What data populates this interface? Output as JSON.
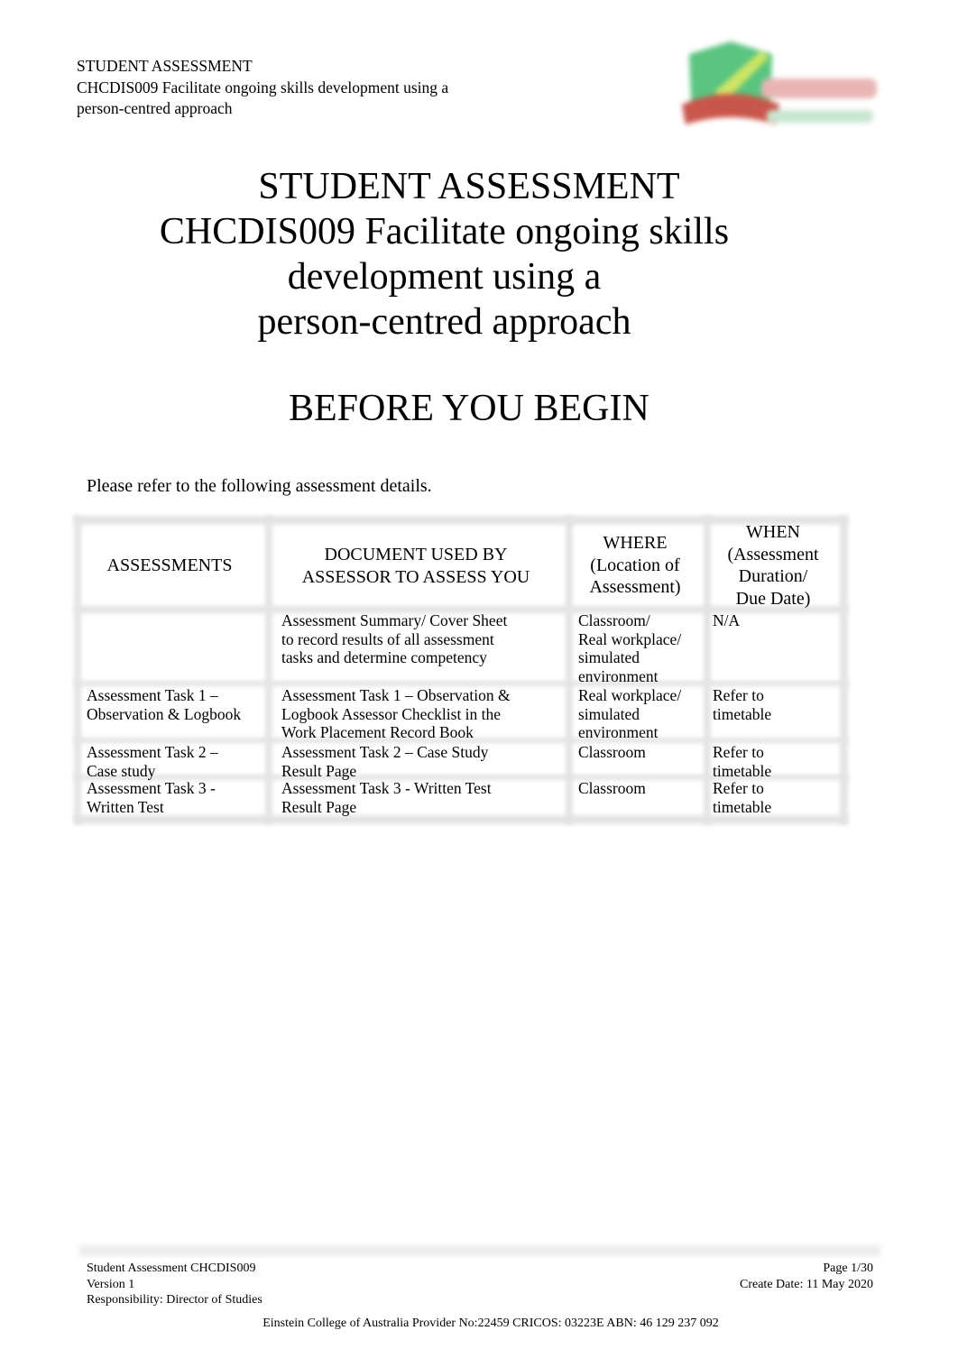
{
  "running_header": {
    "line1": "STUDENT ASSESSMENT",
    "line2": "CHCDIS009 Facilitate ongoing skills development using a",
    "line3": "person-centred approach"
  },
  "logo": {
    "icon": "college-crest-logo",
    "colors": {
      "shield_green": "#3dbb6a",
      "stripe_yellow": "#c6e04a",
      "ribbon_red": "#c0392b",
      "wordmark_red": "#e6a8a8",
      "wordmark_green": "#bfe3c9"
    }
  },
  "title": {
    "line1": "STUDENT ASSESSMENT",
    "line2": "CHCDIS009 Facilitate ongoing skills",
    "line3": "development using a",
    "line4": "person-centred approach"
  },
  "section_heading": "BEFORE YOU BEGIN",
  "intro_text": "Please refer to the following assessment details.",
  "table": {
    "headers": {
      "assessments": [
        "ASSESSMENTS"
      ],
      "document": [
        "DOCUMENT USED BY",
        "ASSESSOR TO ASSESS YOU"
      ],
      "where": [
        "WHERE",
        "(Location of",
        "Assessment)"
      ],
      "when": [
        "WHEN",
        "(Assessment",
        "Duration/",
        "Due Date)"
      ]
    },
    "rows": [
      {
        "assessment": [],
        "document": [
          "Assessment Summary/ Cover Sheet",
          "to record results of all assessment",
          "tasks and determine competency"
        ],
        "where": [
          "Classroom/",
          "Real workplace/",
          "simulated",
          "environment"
        ],
        "when": [
          "N/A"
        ]
      },
      {
        "assessment": [
          "Assessment Task 1 –",
          "Observation & Logbook"
        ],
        "document": [
          "Assessment Task 1 – Observation &",
          "Logbook Assessor Checklist in the",
          "Work Placement Record Book"
        ],
        "where": [
          "Real workplace/",
          "simulated",
          "environment"
        ],
        "when": [
          "Refer to",
          "timetable"
        ]
      },
      {
        "assessment": [
          "Assessment Task 2 –",
          "Case study"
        ],
        "document": [
          "Assessment Task 2 – Case Study",
          "Result Page"
        ],
        "where": [
          "Classroom"
        ],
        "when": [
          "Refer to",
          "timetable"
        ]
      },
      {
        "assessment": [
          "Assessment Task 3 -",
          "Written Test"
        ],
        "document": [
          "Assessment Task 3 - Written Test",
          "Result Page"
        ],
        "where": [
          "Classroom"
        ],
        "when": [
          "Refer to",
          "timetable"
        ]
      }
    ]
  },
  "footer": {
    "left": [
      "Student Assessment CHCDIS009",
      "Version 1",
      "Responsibility: Director of Studies"
    ],
    "right": [
      "Page 1/30",
      "Create Date: 11 May 2020"
    ],
    "center": "Einstein College of Australia Provider No:22459 CRICOS: 03223E ABN: 46 129 237 092"
  }
}
